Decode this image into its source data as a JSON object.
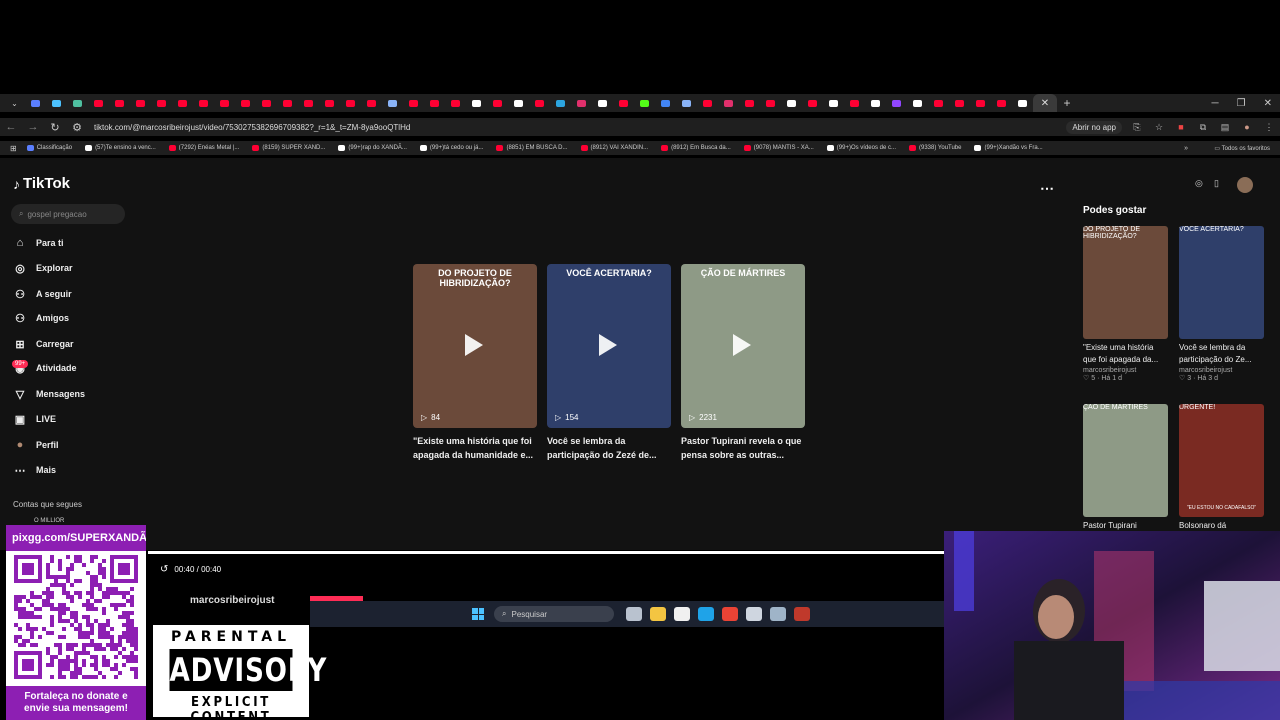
{
  "browser": {
    "tabs": [
      {
        "color": "#5b7fff"
      },
      {
        "color": "#4cc2ff"
      },
      {
        "color": "#4fc0a0"
      },
      {
        "color": "#ff0033"
      },
      {
        "color": "#ff0033"
      },
      {
        "color": "#ff0033"
      },
      {
        "color": "#ff0033"
      },
      {
        "color": "#ff0033"
      },
      {
        "color": "#ff0033"
      },
      {
        "color": "#ff0033"
      },
      {
        "color": "#ff0033"
      },
      {
        "color": "#ff0033"
      },
      {
        "color": "#ff0033"
      },
      {
        "color": "#ff0033"
      },
      {
        "color": "#ff0033"
      },
      {
        "color": "#ff0033"
      },
      {
        "color": "#ff0033"
      },
      {
        "color": "#8ab4f8"
      },
      {
        "color": "#ff0033"
      },
      {
        "color": "#ff0033"
      },
      {
        "color": "#ff0033"
      },
      {
        "color": "#ffffff"
      },
      {
        "color": "#ff0033"
      },
      {
        "color": "#ffffff"
      },
      {
        "color": "#ff0033"
      },
      {
        "color": "#2ca5e0"
      },
      {
        "color": "#e1306c"
      },
      {
        "color": "#ffffff"
      },
      {
        "color": "#ff0033"
      },
      {
        "color": "#53fc18"
      },
      {
        "color": "#4285f4"
      },
      {
        "color": "#8ab4f8"
      },
      {
        "color": "#ff0033"
      },
      {
        "color": "#e1306c"
      },
      {
        "color": "#ff0033"
      },
      {
        "color": "#ff0033"
      },
      {
        "color": "#ffffff"
      },
      {
        "color": "#ff0033"
      },
      {
        "color": "#ffffff"
      },
      {
        "color": "#ff0033"
      },
      {
        "color": "#ffffff"
      },
      {
        "color": "#9146ff"
      },
      {
        "color": "#ffffff"
      },
      {
        "color": "#ff0033"
      },
      {
        "color": "#ff0033"
      },
      {
        "color": "#ff0033"
      },
      {
        "color": "#ff0033"
      },
      {
        "color": "#ffffff"
      }
    ],
    "active_tab_icon": "close-icon",
    "url": "tiktok.com/@marcosribeirojust/video/7530275382696709382?_r=1&_t=ZM-8ya9ooQTlHd",
    "open_app_label": "Abrir no app",
    "bookmarks": [
      {
        "label": "Classificação",
        "color": "#5b7fff"
      },
      {
        "label": "(57)Te ensino a venc...",
        "color": "#ffffff"
      },
      {
        "label": "(7292) Enéas Metal |...",
        "color": "#ff0033"
      },
      {
        "label": "(8159) SUPER XAND...",
        "color": "#ff0033"
      },
      {
        "label": "(99+)rap do XANDÃ...",
        "color": "#ffffff"
      },
      {
        "label": "(99+)tá cedo ou já...",
        "color": "#ffffff"
      },
      {
        "label": "(8851) EM BUSCA D...",
        "color": "#ff0033"
      },
      {
        "label": "(8912) VAI XANDIN...",
        "color": "#ff0033"
      },
      {
        "label": "(8912) Em Busca da...",
        "color": "#ff0033"
      },
      {
        "label": "(9078) MANTIS - XA...",
        "color": "#ff0033"
      },
      {
        "label": "(99+)Os vídeos de c...",
        "color": "#ffffff"
      },
      {
        "label": "(9338) YouTube",
        "color": "#ff0033"
      },
      {
        "label": "(99+)Xandão vs Fra...",
        "color": "#ffffff"
      }
    ],
    "all_bookmarks": "Todos os favoritos"
  },
  "tiktok": {
    "logo": "TikTok",
    "search_placeholder": "gospel pregacao",
    "nav": [
      {
        "label": "Para ti",
        "icon": "home-icon"
      },
      {
        "label": "Explorar",
        "icon": "compass-icon"
      },
      {
        "label": "A seguir",
        "icon": "following-icon"
      },
      {
        "label": "Amigos",
        "icon": "friends-icon"
      },
      {
        "label": "Carregar",
        "icon": "upload-icon"
      },
      {
        "label": "Atividade",
        "icon": "inbox-icon"
      },
      {
        "label": "Mensagens",
        "icon": "message-icon"
      },
      {
        "label": "LIVE",
        "icon": "live-icon"
      },
      {
        "label": "Perfil",
        "icon": "avatar-icon"
      },
      {
        "label": "Mais",
        "icon": "more-icon"
      }
    ],
    "activity_badge": "99+",
    "following_heading": "Contas que segues",
    "following_account": "O MILLIOR",
    "videos": [
      {
        "header": "DO PROJETO DE HIBRIDIZAÇÃO?",
        "views": "84",
        "caption1": "\"Existe uma história que foi",
        "caption2": "apagada da humanidade e...",
        "bg": "#6b4a3a"
      },
      {
        "header": "VOCÊ ACERTARIA?",
        "views": "154",
        "caption1": "Você se lembra da",
        "caption2": "participação do Zezé de...",
        "bg": "#2f3f6a"
      },
      {
        "header": "ÇÃO DE MÁRTIRES",
        "views": "2231",
        "caption1": "Pastor Tupirani revela o que",
        "caption2": "pensa sobre as outras...",
        "bg": "#8e9a86"
      }
    ],
    "recommended_title": "Podes gostar",
    "recommended": [
      {
        "caption1": "\"Existe uma história",
        "caption2": "que foi apagada da...",
        "author": "marcosribeirojust",
        "likes": "5",
        "age": "Há 1 d",
        "bg": "#6b4a3a",
        "header": "DO PROJETO DE HIBRIDIZAÇÃO?"
      },
      {
        "caption1": "Você se lembra da",
        "caption2": "participação do Ze...",
        "author": "marcosribeirojust",
        "likes": "3",
        "age": "Há 3 d",
        "bg": "#2f3f6a",
        "header": "VOCÊ ACERTARIA?"
      },
      {
        "caption1": "Pastor Tupirani",
        "caption2": "",
        "author": "",
        "likes": "",
        "age": "",
        "bg": "#8e9a86",
        "header": "ÇÃO DE MÁRTIRES"
      },
      {
        "caption1": "Bolsonaro dá",
        "caption2": "",
        "author": "",
        "likes": "",
        "age": "",
        "bg": "#7a2a22",
        "header": "URGENTE!"
      }
    ],
    "rec_banner": "\"EU ESTOU NO CADAFALSO\""
  },
  "player": {
    "time": "00:40 / 00:40",
    "progress": 1.0,
    "author": "marcosribeirojust"
  },
  "taskbar": {
    "search_placeholder": "Pesquisar",
    "apps": [
      "#b9c2cf",
      "#f4c542",
      "#f0f0f0",
      "#1fa3e8",
      "#ea4335",
      "#cfd6e0",
      "#9fb4c8",
      "#c0392b"
    ]
  },
  "overlays": {
    "qr_header": "pixgg.com/SUPERXANDÃ",
    "qr_footer1": "Fortaleça no donate e",
    "qr_footer2": "envie sua mensagem!",
    "advisory_top": "PARENTAL",
    "advisory_mid": "ADVISORY",
    "advisory_bot": "EXPLICIT CONTENT"
  },
  "colors": {
    "tiktok_red": "#fe2c55",
    "qr_purple": "#8d1fb3",
    "taskbar": "#1c2230"
  }
}
